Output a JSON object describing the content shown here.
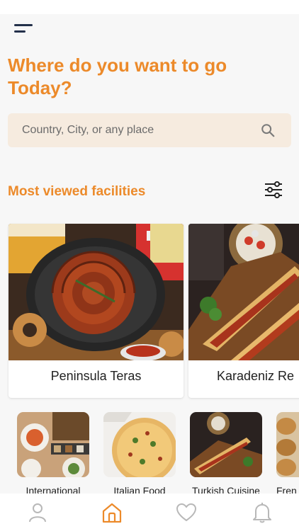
{
  "header": {
    "menu_icon": "menu-icon",
    "headline": "Where do you want to go Today?"
  },
  "search": {
    "placeholder": "Country, City, or any place",
    "value": "",
    "icon": "search-icon"
  },
  "facilities": {
    "title": "Most viewed facilities",
    "filter_icon": "sliders-icon",
    "items": [
      {
        "name": "Peninsula Teras"
      },
      {
        "name": "Karadeniz Re"
      }
    ]
  },
  "categories": [
    {
      "label": "International"
    },
    {
      "label": "Italian Food"
    },
    {
      "label": "Turkish Cuisine"
    },
    {
      "label": "Fren"
    }
  ],
  "bottom_nav": {
    "items": [
      {
        "icon": "user-icon",
        "active": false
      },
      {
        "icon": "home-icon",
        "active": true
      },
      {
        "icon": "heart-icon",
        "active": false
      },
      {
        "icon": "bell-icon",
        "active": false
      }
    ]
  },
  "colors": {
    "accent": "#ec8a2a",
    "search_bg": "#f6ebdf",
    "background": "#f7f7f7",
    "menu": "#23304a",
    "nav_inactive": "#b8b8b8"
  }
}
